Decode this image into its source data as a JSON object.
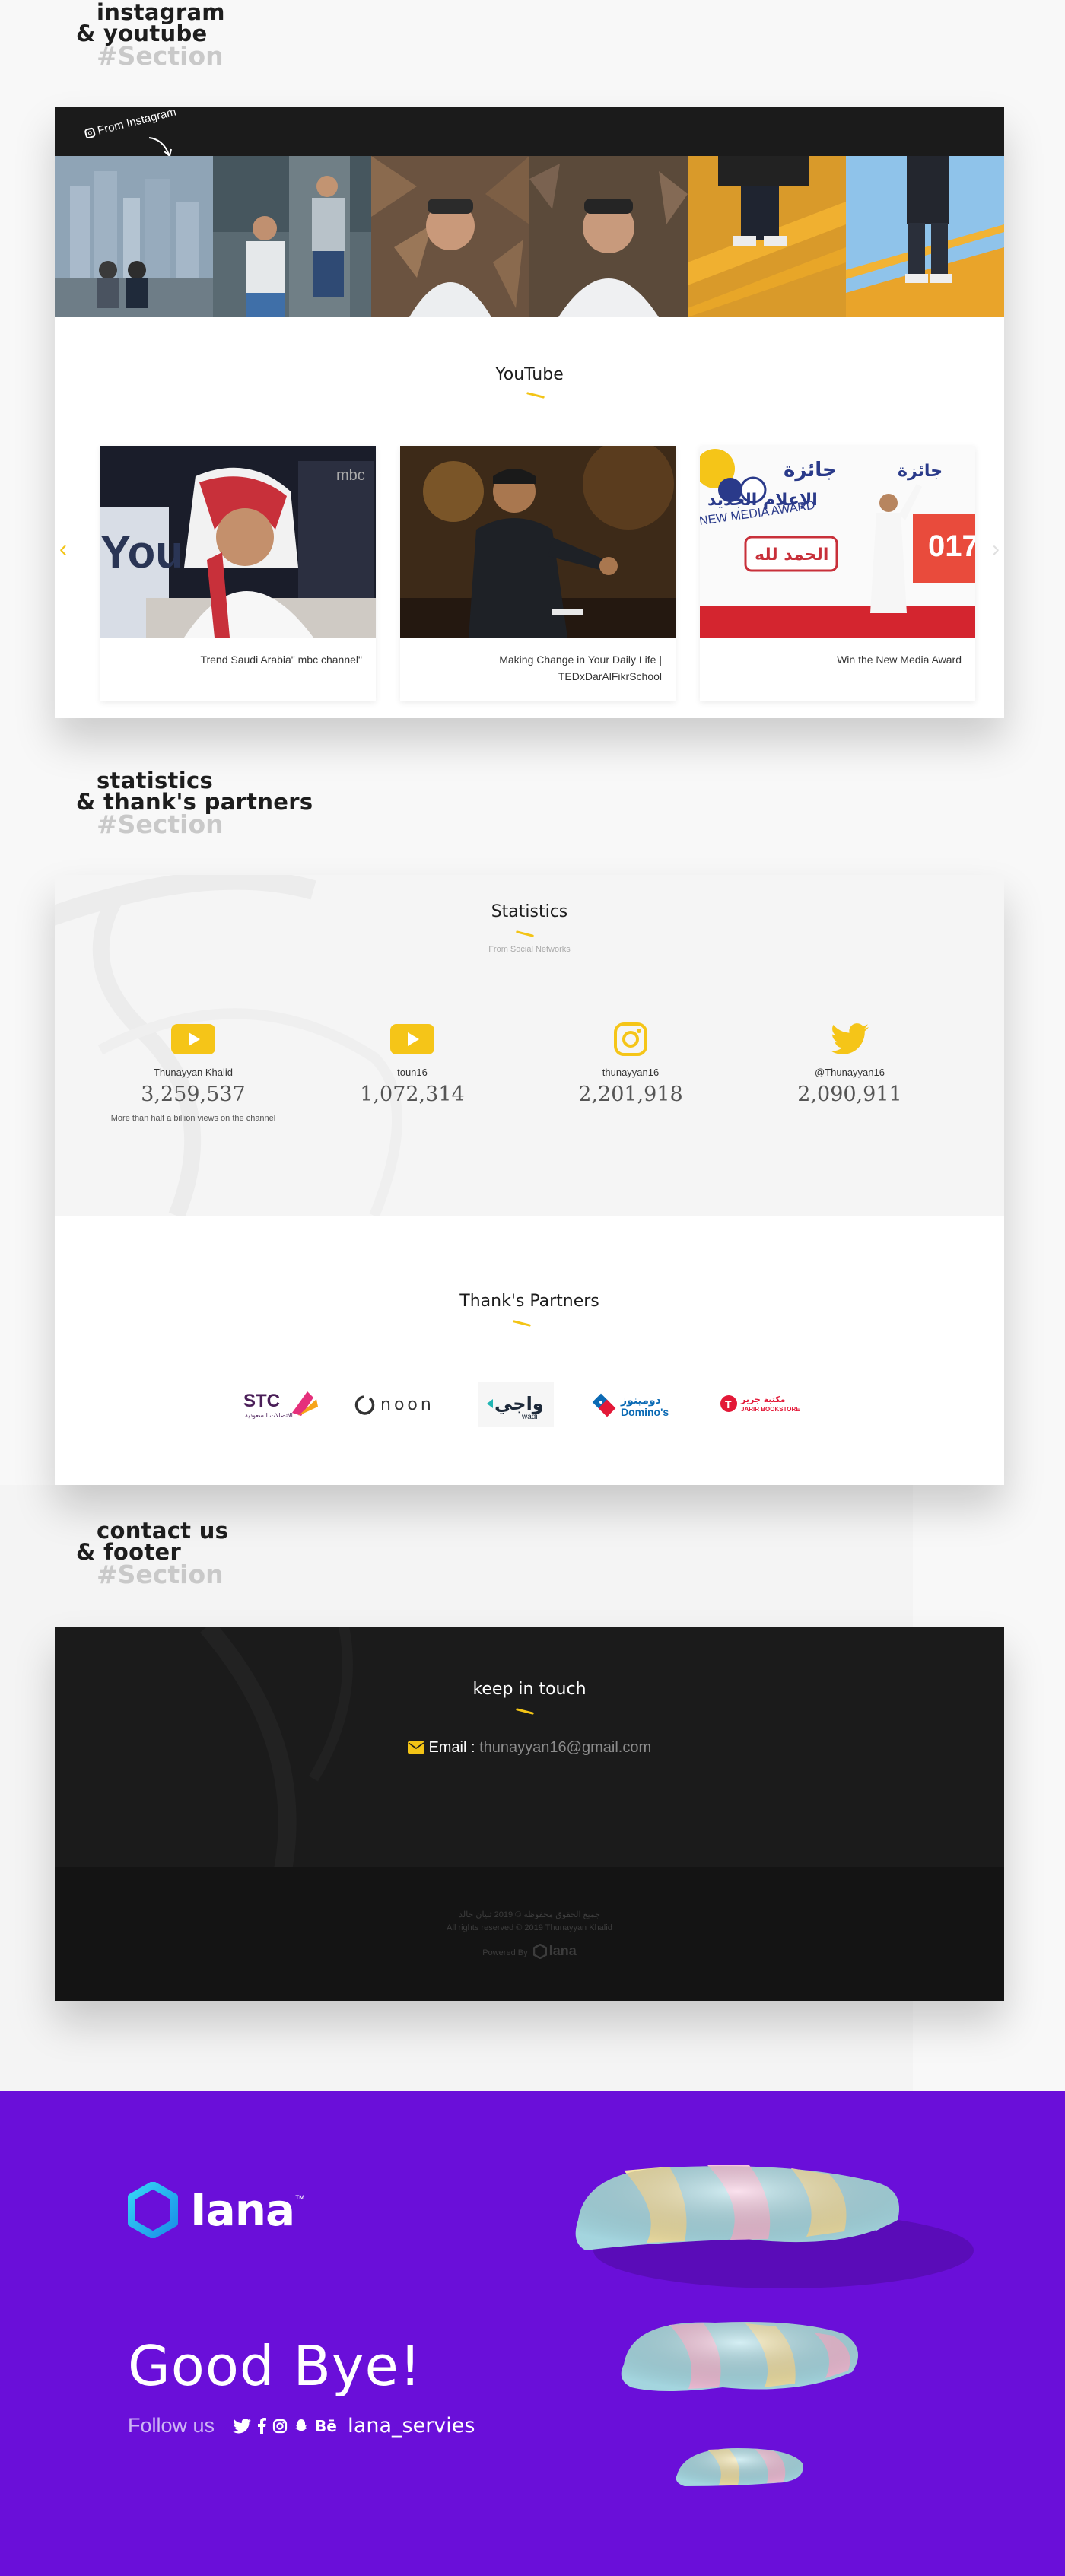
{
  "section1": {
    "line1": "instagram",
    "line2": "& youtube",
    "tag": "#Section"
  },
  "instagram": {
    "label": "From Instagram"
  },
  "youtube": {
    "title": "YouTube",
    "videos": [
      {
        "caption": "Trend Saudi Arabia\" mbc channel\""
      },
      {
        "caption": "Making Change in Your Daily Life | TEDxDarAlFikrSchool"
      },
      {
        "caption": "Win the New Media Award"
      }
    ],
    "thumb3_text": {
      "arabic1": "جائزة",
      "arabic2": "الإعلام الجديد",
      "award": "NEW MEDIA AWARD",
      "hamd": "الحمد لله",
      "year": "017"
    }
  },
  "section2": {
    "line1": "statistics",
    "line2": "& thank's partners",
    "tag": "#Section"
  },
  "statistics": {
    "title": "Statistics",
    "subtitle": "From Social Networks",
    "items": [
      {
        "icon": "youtube-icon",
        "name": "Thunayyan Khalid",
        "value": "3,259,537",
        "note": "More than half a billion views on the channel"
      },
      {
        "icon": "youtube-icon",
        "name": "toun16",
        "value": "1,072,314"
      },
      {
        "icon": "instagram-icon",
        "name": "thunayyan16",
        "value": "2,201,918"
      },
      {
        "icon": "twitter-icon",
        "name": "@Thunayyan16",
        "value": "2,090,911"
      }
    ]
  },
  "partners": {
    "title": "Thank's Partners",
    "logos": [
      {
        "name": "STC",
        "sub": "الاتصالات السعودية"
      },
      {
        "name": "noon"
      },
      {
        "name": "واجي",
        "sub": "wadi"
      },
      {
        "name": "دومينوز",
        "sub": "Domino's"
      },
      {
        "name": "مكتبة جرير",
        "sub": "JARIR BOOKSTORE"
      }
    ]
  },
  "section3": {
    "line1": "contact us",
    "line2": "& footer",
    "tag": "#Section"
  },
  "contact": {
    "title": "keep in touch",
    "email_label": "Email : ",
    "email_value": "thunayyan16@gmail.com"
  },
  "footer": {
    "line1": "جميع الحقوق محفوظة © 2019 ثنيان خالد",
    "line2": "All rights reserved © 2019 Thunayyan Khalid",
    "powered": "Powered By",
    "powered_brand": "Iana"
  },
  "closing": {
    "brand": "Iana",
    "tm": "™",
    "goodbye": "Good Bye!",
    "follow": "Follow us",
    "handle": "Iana_servies",
    "bg_color": "#6a0fd9"
  },
  "colors": {
    "accent": "#f3c416",
    "dark": "#1b1b1b"
  }
}
